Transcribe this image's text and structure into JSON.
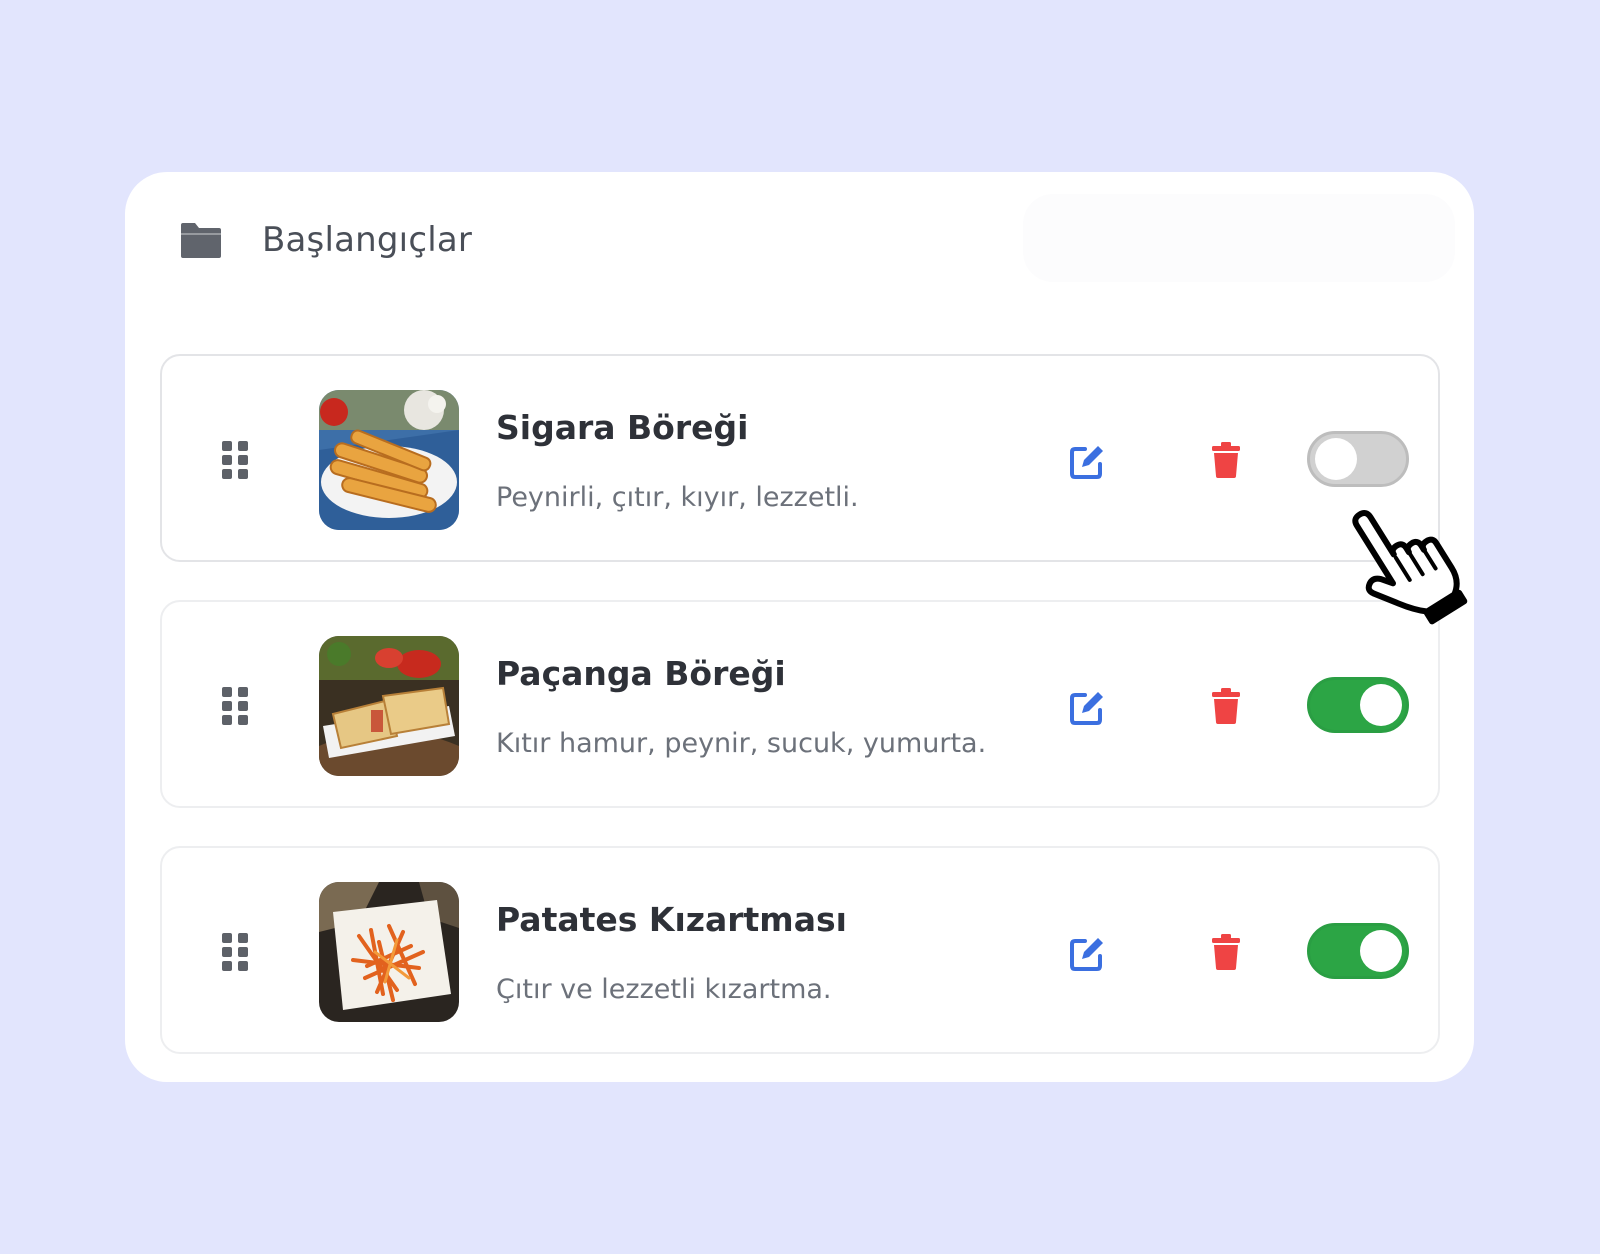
{
  "section": {
    "title": "Başlangıçlar",
    "icon": "folder-icon"
  },
  "items": [
    {
      "name": "Sigara Böreği",
      "description": "Peynirli, çıtır, kıyır, lezzetli.",
      "active": false,
      "image": "sigara-boregi-photo"
    },
    {
      "name": "Paçanga Böreği",
      "description": "Kıtır hamur, peynir, sucuk, yumurta.",
      "active": true,
      "image": "pacanga-boregi-photo"
    },
    {
      "name": "Patates Kızartması",
      "description": "Çıtır ve lezzetli kızartma.",
      "active": true,
      "image": "patates-kizartmasi-photo"
    }
  ],
  "icons": {
    "drag": "drag-handle-icon",
    "edit": "edit-icon",
    "delete": "trash-icon",
    "cursor": "hand-pointer-cursor-icon"
  },
  "colors": {
    "background": "#e2e5fd",
    "edit": "#3b6fe0",
    "delete": "#ef4444",
    "toggle_on": "#2ca545",
    "toggle_off": "#d1d1d1"
  }
}
